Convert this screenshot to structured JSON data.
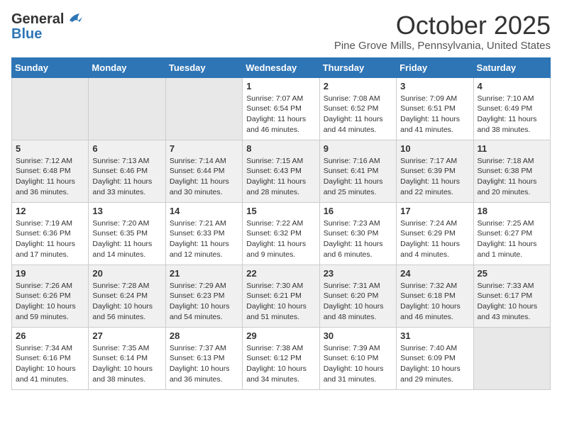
{
  "logo": {
    "general": "General",
    "blue": "Blue"
  },
  "title": "October 2025",
  "location": "Pine Grove Mills, Pennsylvania, United States",
  "days_of_week": [
    "Sunday",
    "Monday",
    "Tuesday",
    "Wednesday",
    "Thursday",
    "Friday",
    "Saturday"
  ],
  "weeks": [
    [
      {
        "day": "",
        "info": ""
      },
      {
        "day": "",
        "info": ""
      },
      {
        "day": "",
        "info": ""
      },
      {
        "day": "1",
        "info": "Sunrise: 7:07 AM\nSunset: 6:54 PM\nDaylight: 11 hours and 46 minutes."
      },
      {
        "day": "2",
        "info": "Sunrise: 7:08 AM\nSunset: 6:52 PM\nDaylight: 11 hours and 44 minutes."
      },
      {
        "day": "3",
        "info": "Sunrise: 7:09 AM\nSunset: 6:51 PM\nDaylight: 11 hours and 41 minutes."
      },
      {
        "day": "4",
        "info": "Sunrise: 7:10 AM\nSunset: 6:49 PM\nDaylight: 11 hours and 38 minutes."
      }
    ],
    [
      {
        "day": "5",
        "info": "Sunrise: 7:12 AM\nSunset: 6:48 PM\nDaylight: 11 hours and 36 minutes."
      },
      {
        "day": "6",
        "info": "Sunrise: 7:13 AM\nSunset: 6:46 PM\nDaylight: 11 hours and 33 minutes."
      },
      {
        "day": "7",
        "info": "Sunrise: 7:14 AM\nSunset: 6:44 PM\nDaylight: 11 hours and 30 minutes."
      },
      {
        "day": "8",
        "info": "Sunrise: 7:15 AM\nSunset: 6:43 PM\nDaylight: 11 hours and 28 minutes."
      },
      {
        "day": "9",
        "info": "Sunrise: 7:16 AM\nSunset: 6:41 PM\nDaylight: 11 hours and 25 minutes."
      },
      {
        "day": "10",
        "info": "Sunrise: 7:17 AM\nSunset: 6:39 PM\nDaylight: 11 hours and 22 minutes."
      },
      {
        "day": "11",
        "info": "Sunrise: 7:18 AM\nSunset: 6:38 PM\nDaylight: 11 hours and 20 minutes."
      }
    ],
    [
      {
        "day": "12",
        "info": "Sunrise: 7:19 AM\nSunset: 6:36 PM\nDaylight: 11 hours and 17 minutes."
      },
      {
        "day": "13",
        "info": "Sunrise: 7:20 AM\nSunset: 6:35 PM\nDaylight: 11 hours and 14 minutes."
      },
      {
        "day": "14",
        "info": "Sunrise: 7:21 AM\nSunset: 6:33 PM\nDaylight: 11 hours and 12 minutes."
      },
      {
        "day": "15",
        "info": "Sunrise: 7:22 AM\nSunset: 6:32 PM\nDaylight: 11 hours and 9 minutes."
      },
      {
        "day": "16",
        "info": "Sunrise: 7:23 AM\nSunset: 6:30 PM\nDaylight: 11 hours and 6 minutes."
      },
      {
        "day": "17",
        "info": "Sunrise: 7:24 AM\nSunset: 6:29 PM\nDaylight: 11 hours and 4 minutes."
      },
      {
        "day": "18",
        "info": "Sunrise: 7:25 AM\nSunset: 6:27 PM\nDaylight: 11 hours and 1 minute."
      }
    ],
    [
      {
        "day": "19",
        "info": "Sunrise: 7:26 AM\nSunset: 6:26 PM\nDaylight: 10 hours and 59 minutes."
      },
      {
        "day": "20",
        "info": "Sunrise: 7:28 AM\nSunset: 6:24 PM\nDaylight: 10 hours and 56 minutes."
      },
      {
        "day": "21",
        "info": "Sunrise: 7:29 AM\nSunset: 6:23 PM\nDaylight: 10 hours and 54 minutes."
      },
      {
        "day": "22",
        "info": "Sunrise: 7:30 AM\nSunset: 6:21 PM\nDaylight: 10 hours and 51 minutes."
      },
      {
        "day": "23",
        "info": "Sunrise: 7:31 AM\nSunset: 6:20 PM\nDaylight: 10 hours and 48 minutes."
      },
      {
        "day": "24",
        "info": "Sunrise: 7:32 AM\nSunset: 6:18 PM\nDaylight: 10 hours and 46 minutes."
      },
      {
        "day": "25",
        "info": "Sunrise: 7:33 AM\nSunset: 6:17 PM\nDaylight: 10 hours and 43 minutes."
      }
    ],
    [
      {
        "day": "26",
        "info": "Sunrise: 7:34 AM\nSunset: 6:16 PM\nDaylight: 10 hours and 41 minutes."
      },
      {
        "day": "27",
        "info": "Sunrise: 7:35 AM\nSunset: 6:14 PM\nDaylight: 10 hours and 38 minutes."
      },
      {
        "day": "28",
        "info": "Sunrise: 7:37 AM\nSunset: 6:13 PM\nDaylight: 10 hours and 36 minutes."
      },
      {
        "day": "29",
        "info": "Sunrise: 7:38 AM\nSunset: 6:12 PM\nDaylight: 10 hours and 34 minutes."
      },
      {
        "day": "30",
        "info": "Sunrise: 7:39 AM\nSunset: 6:10 PM\nDaylight: 10 hours and 31 minutes."
      },
      {
        "day": "31",
        "info": "Sunrise: 7:40 AM\nSunset: 6:09 PM\nDaylight: 10 hours and 29 minutes."
      },
      {
        "day": "",
        "info": ""
      }
    ]
  ]
}
